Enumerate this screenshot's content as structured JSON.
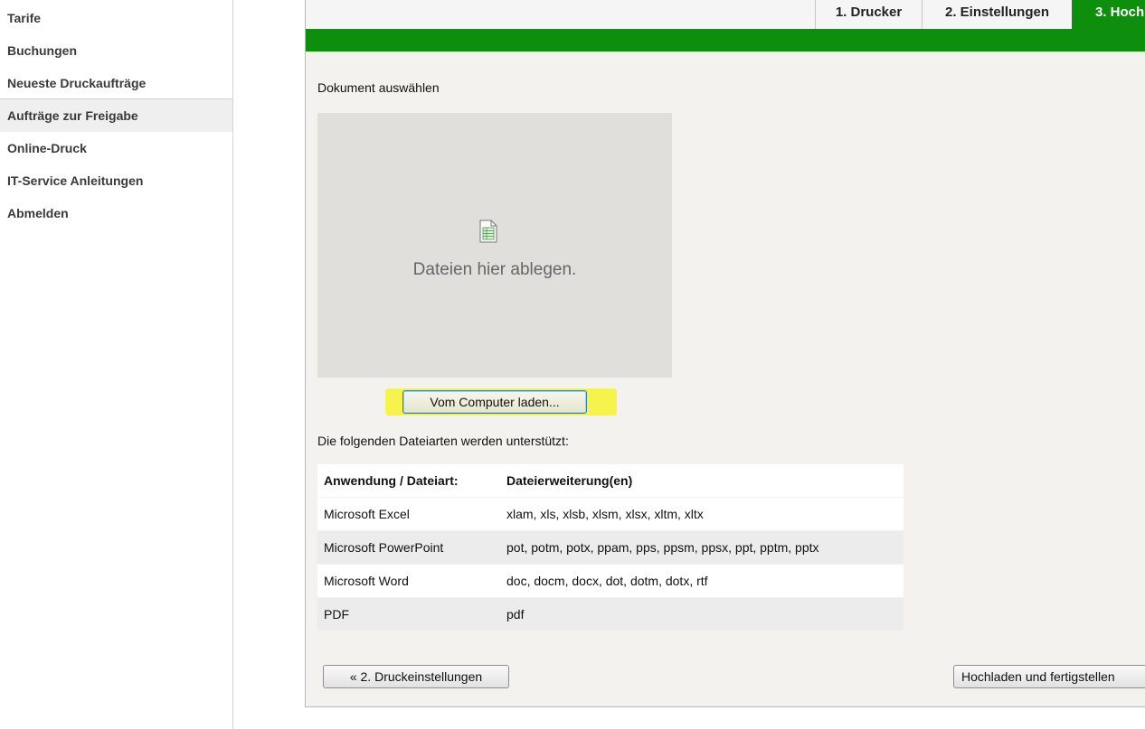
{
  "sidebar": {
    "items": [
      {
        "label": "Tarife"
      },
      {
        "label": "Buchungen"
      },
      {
        "label": "Neueste Druckaufträge"
      },
      {
        "label": "Aufträge zur Freigabe"
      },
      {
        "label": "Online-Druck"
      },
      {
        "label": "IT-Service Anleitungen"
      },
      {
        "label": "Abmelden"
      }
    ]
  },
  "wizard": {
    "tabs": [
      {
        "label": "1. Drucker"
      },
      {
        "label": "2. Einstellungen"
      },
      {
        "label": "3. Hoch"
      }
    ],
    "accent_color": "#0d8e0d"
  },
  "upload": {
    "section_label": "Dokument auswählen",
    "drop_text": "Dateien hier ablegen.",
    "button_label": "Vom Computer laden...",
    "supported_label": "Die folgenden Dateiarten werden unterstützt:"
  },
  "filetypes": {
    "headers": [
      "Anwendung / Dateiart:",
      "Dateierweiterung(en)"
    ],
    "rows": [
      [
        "Microsoft Excel",
        "xlam, xls, xlsb, xlsm, xlsx, xltm, xltx"
      ],
      [
        "Microsoft PowerPoint",
        "pot, potm, potx, ppam, pps, ppsm, ppsx, ppt, pptm, pptx"
      ],
      [
        "Microsoft Word",
        "doc, docm, docx, dot, dotm, dotx, rtf"
      ],
      [
        "PDF",
        "pdf"
      ]
    ]
  },
  "footer": {
    "back_label": "« 2. Druckeinstellungen",
    "finish_label": "Hochladen und fertigstellen"
  }
}
